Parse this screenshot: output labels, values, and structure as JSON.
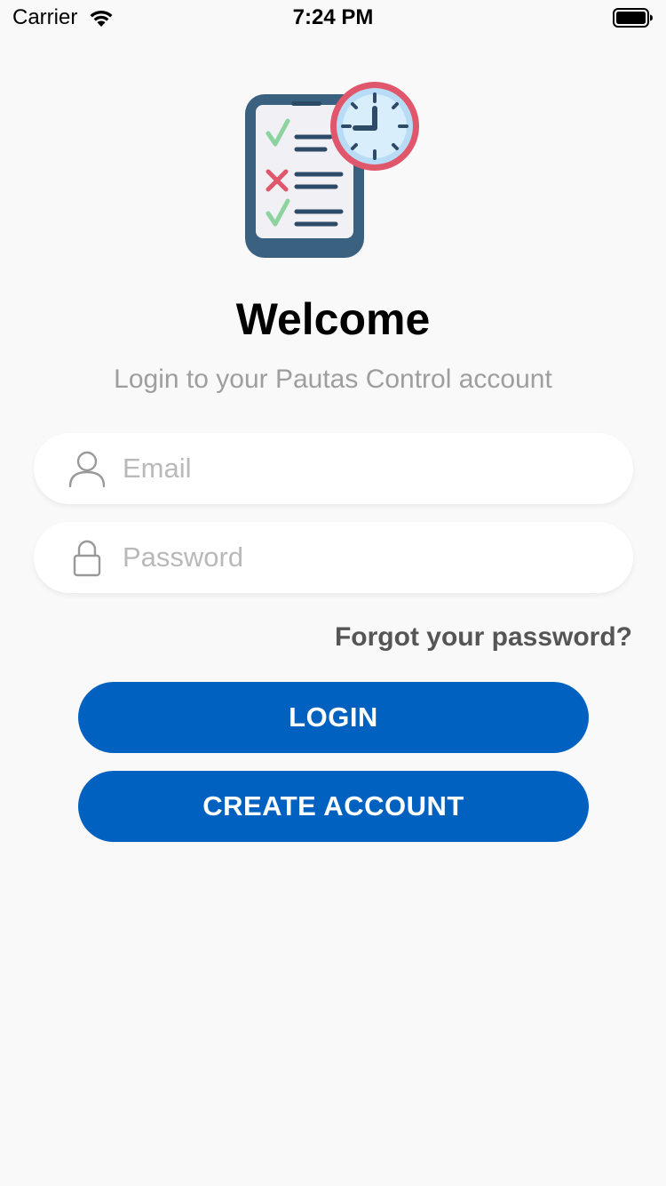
{
  "status_bar": {
    "carrier": "Carrier",
    "time": "7:24 PM",
    "icons": [
      "wifi-icon",
      "battery-icon"
    ]
  },
  "header": {
    "logo_icon": "checklist-clock-icon",
    "title": "Welcome",
    "subtitle": "Login to your Pautas Control account"
  },
  "form": {
    "email": {
      "placeholder": "Email",
      "value": "",
      "icon": "user-icon"
    },
    "password": {
      "placeholder": "Password",
      "value": "",
      "icon": "lock-icon"
    },
    "forgot_label": "Forgot your password?"
  },
  "actions": {
    "login_label": "LOGIN",
    "create_account_label": "CREATE ACCOUNT"
  },
  "colors": {
    "background": "#f9f9f9",
    "primary": "#0061c1",
    "subtitle": "#9e9e9e",
    "link": "#555555"
  }
}
